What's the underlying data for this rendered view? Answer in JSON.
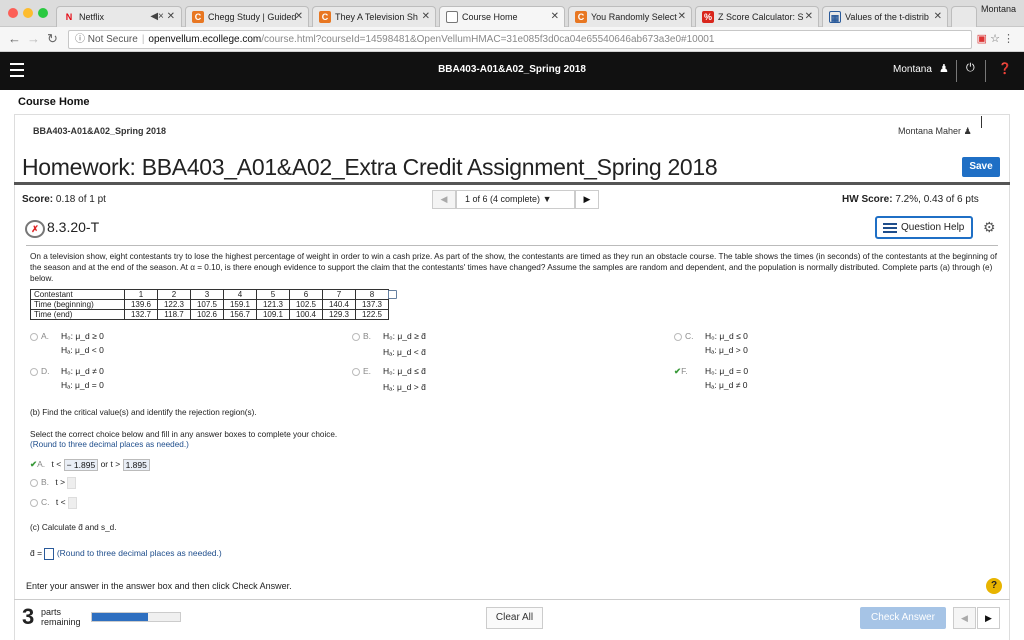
{
  "browser": {
    "tabs": [
      {
        "label": "Netflix",
        "icon": "N"
      },
      {
        "label": "Chegg Study | Guided",
        "icon": "C"
      },
      {
        "label": "They A Television Sh",
        "icon": "C"
      },
      {
        "label": "Course Home",
        "icon": ""
      },
      {
        "label": "You Randomly Select",
        "icon": "C"
      },
      {
        "label": "Z Score Calculator: S",
        "icon": "%"
      },
      {
        "label": "Values of the t-distrib",
        "icon": "▦"
      }
    ],
    "window_user": "Montana",
    "url_secure": "Not Secure",
    "url_host": "openvellum.ecollege.com",
    "url_path": "/course.html?courseId=14598481&OpenVellumHMAC=31e085f3d0ca04e65540646ab673a3e0#10001"
  },
  "appbar": {
    "course": "BBA403-A01&A02_Spring 2018",
    "user": "Montana"
  },
  "page": {
    "course_home": "Course Home",
    "course_name": "BBA403-A01&A02_Spring 2018",
    "student": "Montana Maher",
    "title": "Homework: BBA403_A01&A02_Extra Credit Assignment_Spring 2018",
    "save_label": "Save",
    "score_label": "Score:",
    "score_value": "0.18 of 1 pt",
    "question_select": "1 of 6 (4 complete)",
    "hw_score_label": "HW Score:",
    "hw_score_value": "7.2%, 0.43 of 6 pts",
    "question_id": "8.3.20-T",
    "question_help": "Question Help"
  },
  "problem": {
    "text": "On a television show, eight contestants try to lose the highest percentage of weight in order to win a cash prize. As part of the show, the contestants are timed as they run an obstacle course. The table shows the times (in seconds) of the contestants at the beginning of the season and at the end of the season. At α = 0.10, is there enough evidence to support the claim that the contestants' times have changed? Assume the samples are random and dependent, and the population is normally distributed. Complete parts (a) through (e) below.",
    "table": {
      "header": [
        "Contestant",
        "1",
        "2",
        "3",
        "4",
        "5",
        "6",
        "7",
        "8"
      ],
      "rows": [
        [
          "Time (beginning)",
          "139.6",
          "122.3",
          "107.5",
          "159.1",
          "121.3",
          "102.5",
          "140.4",
          "137.3"
        ],
        [
          "Time (end)",
          "132.7",
          "118.7",
          "102.6",
          "156.7",
          "109.1",
          "100.4",
          "129.3",
          "122.5"
        ]
      ]
    }
  },
  "hypotheses": [
    {
      "letter": "A.",
      "h0": "H₀: μ_d ≥ 0",
      "ha": "Hₐ: μ_d < 0",
      "selected": false
    },
    {
      "letter": "B.",
      "h0": "H₀: μ_d ≥ d̄",
      "ha": "Hₐ: μ_d < d̄",
      "selected": false
    },
    {
      "letter": "C.",
      "h0": "H₀: μ_d ≤ 0",
      "ha": "Hₐ: μ_d > 0",
      "selected": false
    },
    {
      "letter": "D.",
      "h0": "H₀: μ_d ≠ 0",
      "ha": "Hₐ: μ_d = 0",
      "selected": false
    },
    {
      "letter": "E.",
      "h0": "H₀: μ_d ≤ d̄",
      "ha": "Hₐ: μ_d > d̄",
      "selected": false
    },
    {
      "letter": "F.",
      "h0": "H₀: μ_d = 0",
      "ha": "Hₐ: μ_d ≠ 0",
      "selected": true
    }
  ],
  "partb": {
    "prompt": "(b) Find the critical value(s) and identify the rejection region(s).",
    "instruction": "Select the correct choice below and fill in any answer boxes to complete your choice.",
    "round": "(Round to three decimal places as needed.)",
    "optA": {
      "letter": "A.",
      "pre": "t <",
      "v1": "− 1.895",
      "mid": "or t >",
      "v2": "1.895"
    },
    "optB": {
      "letter": "B.",
      "pre": "t >"
    },
    "optC": {
      "letter": "C.",
      "pre": "t <"
    }
  },
  "partc": {
    "prompt": "(c) Calculate d̄ and s_d.",
    "dbar": "d̄ =",
    "round": "(Round to three decimal places as needed.)"
  },
  "footer": {
    "enter": "Enter your answer in the answer box and then click Check Answer.",
    "parts_count": "3",
    "parts_word1": "parts",
    "parts_word2": "remaining",
    "progress": 0.64,
    "clear": "Clear All",
    "check": "Check Answer"
  }
}
